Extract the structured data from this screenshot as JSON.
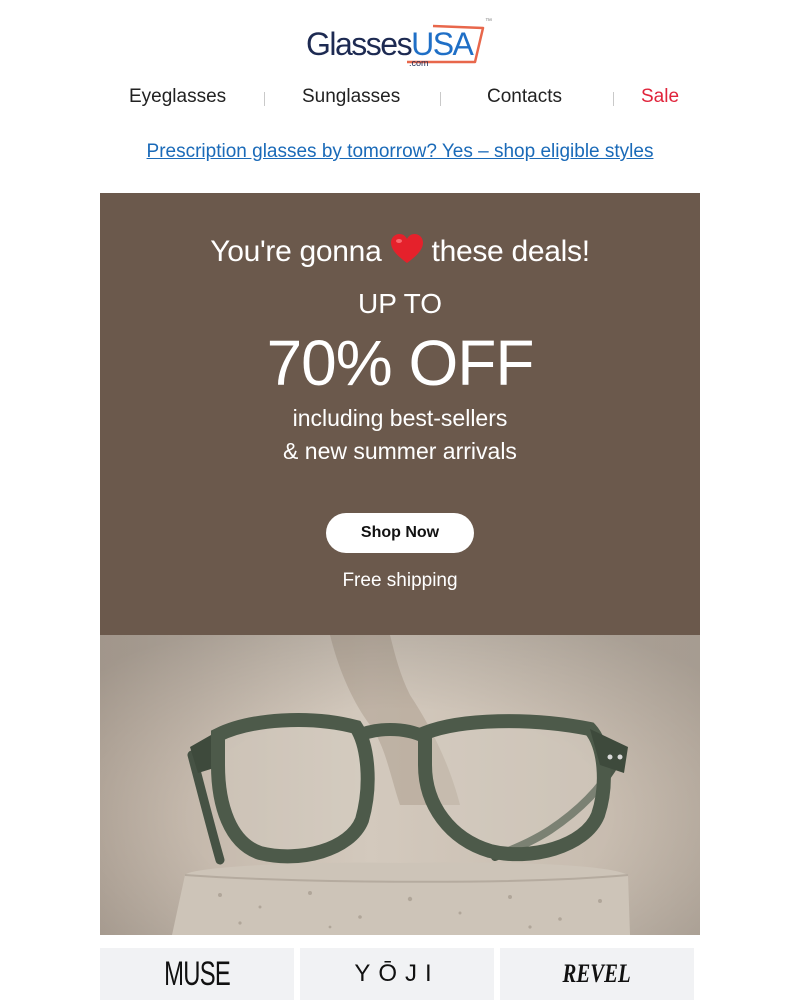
{
  "logo": {
    "brand_part1": "Glasses",
    "brand_part2": "USA",
    "suffix": ".com",
    "tm": "™"
  },
  "nav": {
    "items": [
      {
        "label": "Eyeglasses"
      },
      {
        "label": "Sunglasses"
      },
      {
        "label": "Contacts"
      },
      {
        "label": "Sale"
      }
    ],
    "sale_color": "#e0243b"
  },
  "promo_link": "Prescription glasses by tomorrow? Yes – shop eligible styles",
  "hero": {
    "headline_before": "You're gonna",
    "headline_after": "these deals!",
    "heart_icon": "heart-icon",
    "up_to": "UP TO",
    "discount": "70% OFF",
    "sub_line1": "including best-sellers",
    "sub_line2": "& new summer arrivals",
    "cta_label": "Shop Now",
    "shipping": "Free shipping",
    "background_color": "#6b594c"
  },
  "brands": [
    {
      "name": "MUSE"
    },
    {
      "name": "YŌJI"
    },
    {
      "name": "REVEL"
    }
  ],
  "colors": {
    "link_blue": "#1a6ab8",
    "logo_navy": "#1d2a52",
    "logo_blue": "#1f6fc6"
  }
}
